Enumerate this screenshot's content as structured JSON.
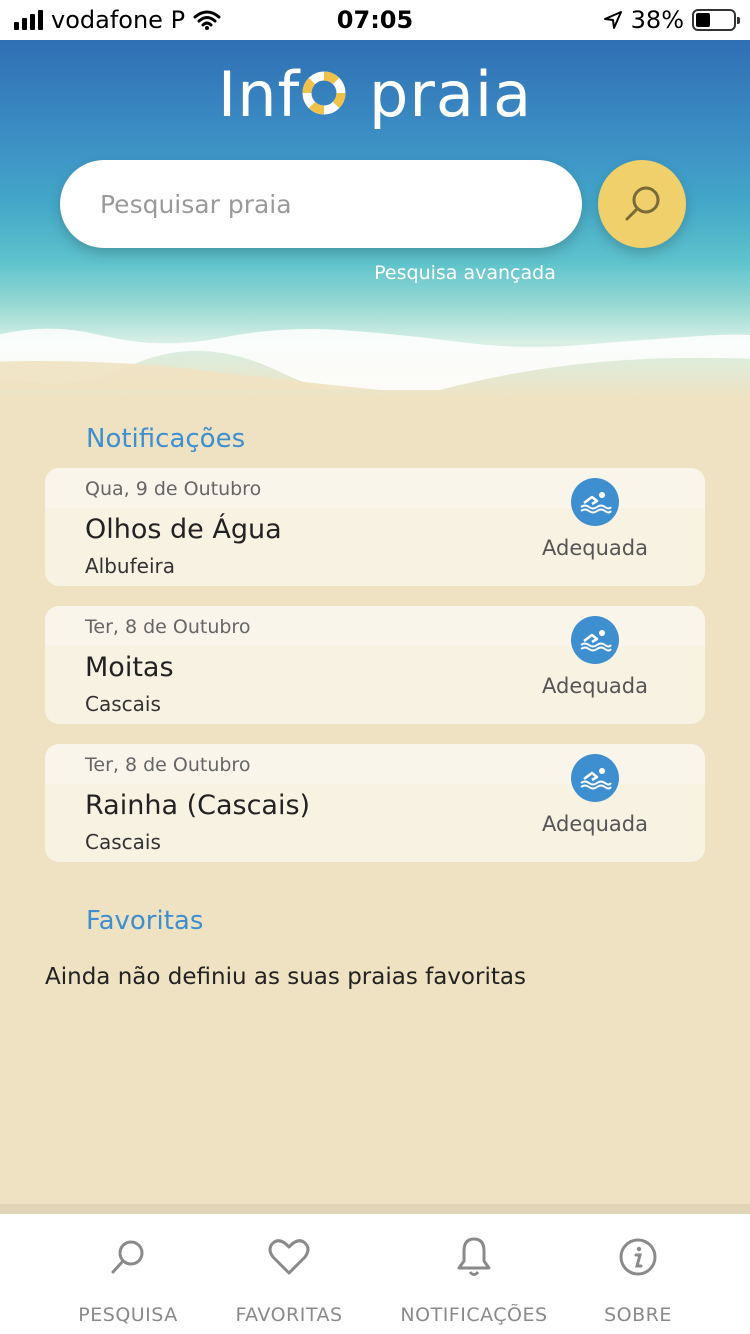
{
  "status_bar": {
    "carrier": "vodafone P",
    "time": "07:05",
    "battery": "38%"
  },
  "header": {
    "title_left": "Inf",
    "title_right": " praia",
    "search_placeholder": "Pesquisar praia",
    "advanced_search": "Pesquisa avançada"
  },
  "notifications": {
    "title": "Notificações",
    "items": [
      {
        "date": "Qua, 9 de Outubro",
        "beach": "Olhos de Água",
        "place": "Albufeira",
        "status": "Adequada"
      },
      {
        "date": "Ter, 8 de Outubro",
        "beach": "Moitas",
        "place": "Cascais",
        "status": "Adequada"
      },
      {
        "date": "Ter, 8 de Outubro",
        "beach": "Rainha (Cascais)",
        "place": "Cascais",
        "status": "Adequada"
      }
    ]
  },
  "favorites": {
    "title": "Favoritas",
    "empty_message": "Ainda não definiu as suas praias favoritas"
  },
  "tab_bar": {
    "search": "PESQUISA",
    "favorites": "FAVORITAS",
    "notifications": "NOTIFICAÇÕES",
    "about": "SOBRE"
  },
  "colors": {
    "accent_blue": "#3d8fcf",
    "search_button": "#f0d06a",
    "sand": "#efe2c2"
  }
}
